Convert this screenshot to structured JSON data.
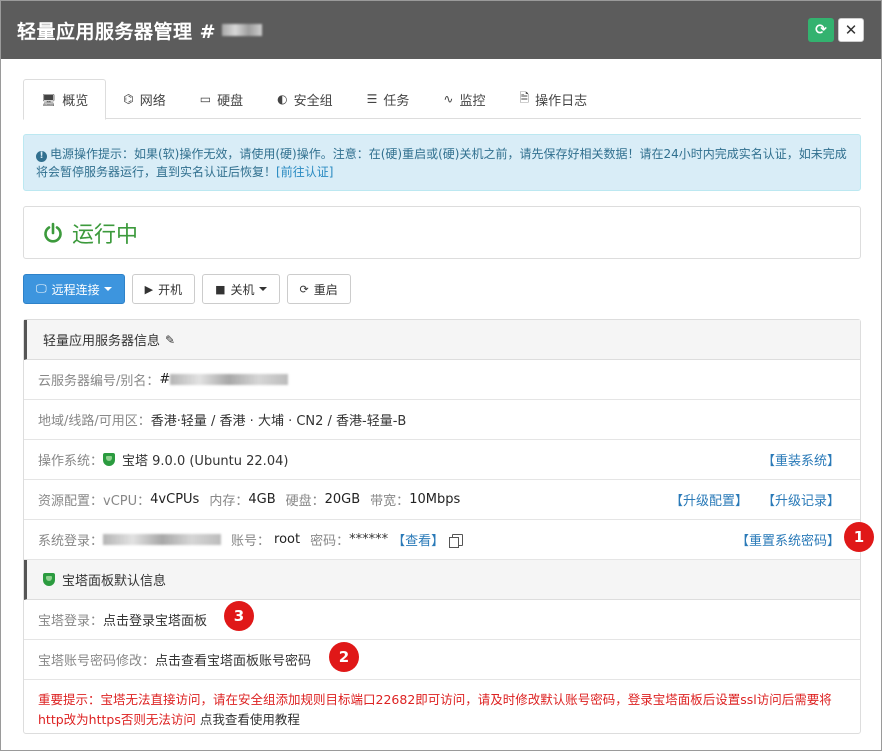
{
  "header": {
    "title": "轻量应用服务器管理 #"
  },
  "tabs": [
    {
      "icon": "🖥",
      "label": "概览"
    },
    {
      "icon": "⌬",
      "label": "网络"
    },
    {
      "icon": "▭",
      "label": "硬盘"
    },
    {
      "icon": "◐",
      "label": "安全组"
    },
    {
      "icon": "☰",
      "label": "任务"
    },
    {
      "icon": "∿",
      "label": "监控"
    },
    {
      "icon": "🗎",
      "label": "操作日志"
    }
  ],
  "alert": {
    "text": "电源操作提示：如果(软)操作无效，请使用(硬)操作。注意：在(硬)重启或(硬)关机之前，请先保存好相关数据！请在24小时内完成实名认证，如未完成将会暂停服务器运行，直到实名认证后恢复！",
    "link": "[前往认证]"
  },
  "status": {
    "text": "运行中"
  },
  "actions": {
    "remote": "远程连接",
    "start": "开机",
    "shutdown": "关机",
    "restart": "重启"
  },
  "info": {
    "title": "轻量应用服务器信息",
    "id_label": "云服务器编号/别名：",
    "id_value": "#",
    "region_label": "地域/线路/可用区：",
    "region_value": "香港·轻量 / 香港 · 大埔 · CN2 / 香港-轻量-B",
    "os_label": "操作系统：",
    "os_value": "宝塔 9.0.0 (Ubuntu 22.04)",
    "os_link": "【重装系统】",
    "res_label": "资源配置：",
    "vcpu_label": "vCPU：",
    "vcpu_value": "4vCPUs",
    "mem_label": "内存：",
    "mem_value": "4GB",
    "disk_label": "硬盘：",
    "disk_value": "20GB",
    "bw_label": "带宽：",
    "bw_value": "10Mbps",
    "upgrade_link": "【升级配置】",
    "upgrade_log_link": "【升级记录】",
    "login_label": "系统登录：",
    "account_label": "账号：",
    "account_value": "root",
    "password_label": "密码：",
    "password_value": "******",
    "view_link": "【查看】",
    "reset_link": "【重置系统密码】"
  },
  "bt": {
    "title": "宝塔面板默认信息",
    "login_label": "宝塔登录：",
    "login_link": "点击登录宝塔面板",
    "pwd_label": "宝塔账号密码修改：",
    "pwd_link": "点击查看宝塔面板账号密码"
  },
  "notice": {
    "text": "重要提示：宝塔无法直接访问，请在安全组添加规则目标端口22682即可访问，请及时修改默认账号密码，登录宝塔面板后设置ssl访问后需要将http改为https否则无法访问",
    "link": "点我查看使用教程"
  },
  "badges": {
    "one": "1",
    "two": "2",
    "three": "3"
  },
  "colors": {
    "header": "#5c5c5c",
    "primary": "#3d95de",
    "running": "#3c9a3c",
    "danger": "#dd2222",
    "badge": "#e01818"
  }
}
